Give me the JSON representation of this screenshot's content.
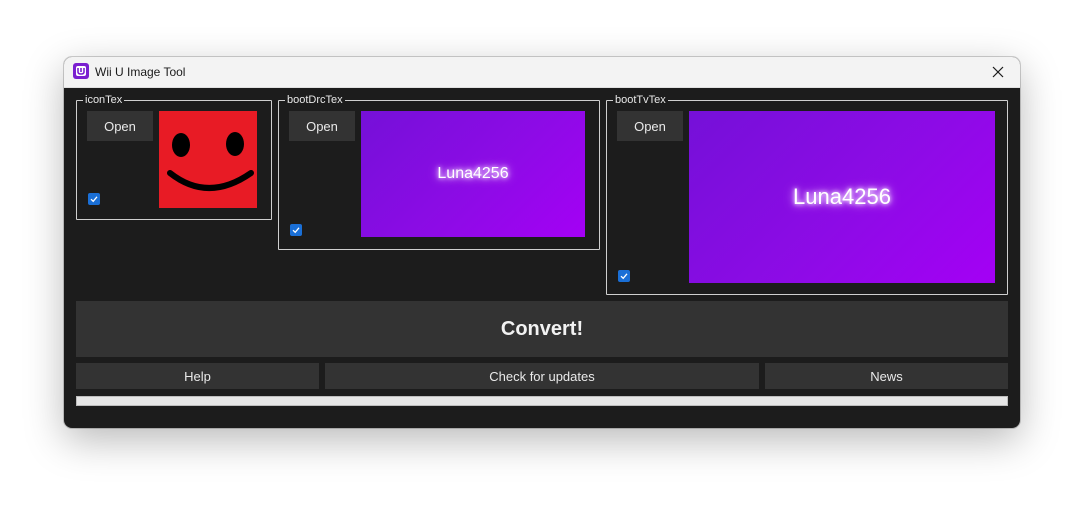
{
  "window": {
    "title": "Wii U Image Tool"
  },
  "groups": {
    "icon": {
      "legend": "iconTex",
      "open_label": "Open",
      "checked": true
    },
    "drc": {
      "legend": "bootDrcTex",
      "open_label": "Open",
      "checked": true,
      "preview_text": "Luna4256"
    },
    "tv": {
      "legend": "bootTvTex",
      "open_label": "Open",
      "checked": true,
      "preview_text": "Luna4256"
    }
  },
  "actions": {
    "convert_label": "Convert!",
    "help_label": "Help",
    "updates_label": "Check for updates",
    "news_label": "News"
  },
  "progress": {
    "value": 0
  },
  "colors": {
    "accent": "#1a6fd6",
    "window_bg": "#1c1c1c",
    "button_bg": "#333333",
    "smiley_bg": "#e81b25",
    "preview_purple": "#8d0be6"
  },
  "icons": {
    "app": "wii-u-app-icon",
    "close": "close-icon",
    "check": "checkmark-icon"
  }
}
